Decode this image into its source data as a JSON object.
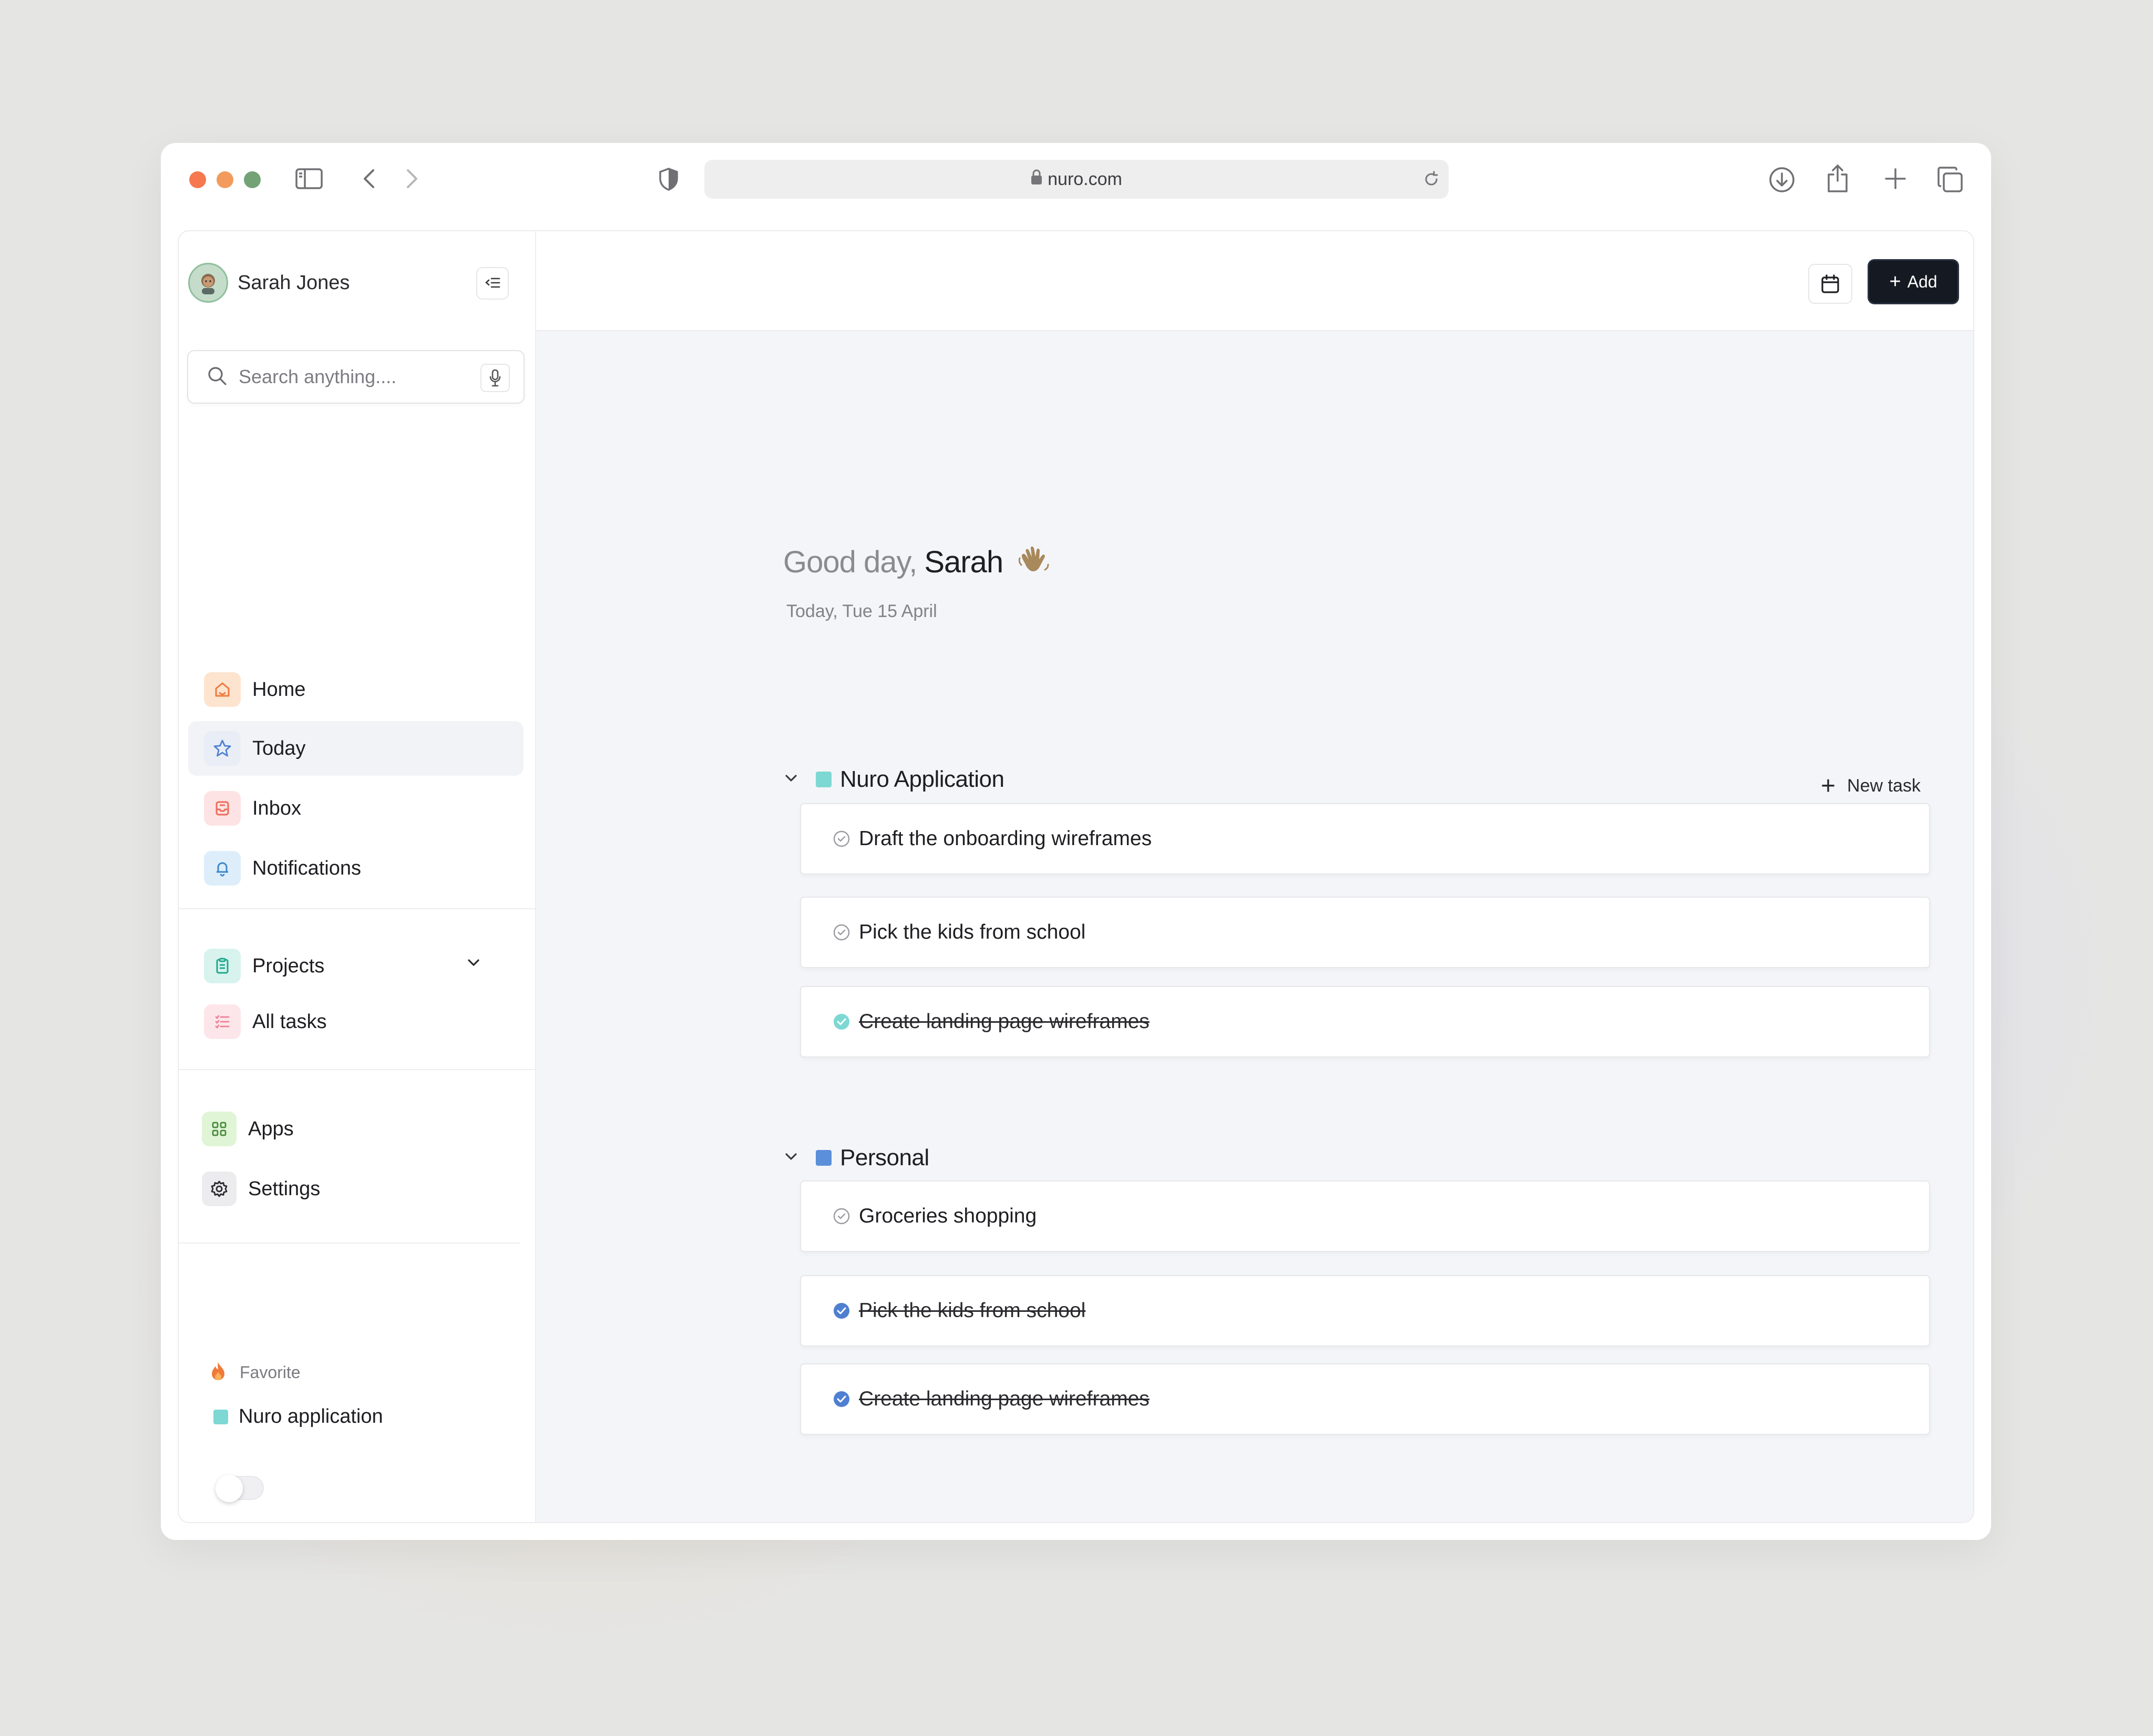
{
  "browser": {
    "url": "nuro.com"
  },
  "user": {
    "name": "Sarah Jones"
  },
  "search": {
    "placeholder": "Search anything...."
  },
  "nav": {
    "home": "Home",
    "today": "Today",
    "inbox": "Inbox",
    "notifications": "Notifications",
    "projects": "Projects",
    "all_tasks": "All tasks",
    "apps": "Apps",
    "settings": "Settings"
  },
  "favorite": {
    "title": "Favorite",
    "item": "Nuro application"
  },
  "toolbar": {
    "add_label": "Add"
  },
  "greeting": {
    "prefix": "Good day,",
    "name": "Sarah",
    "date": "Today, Tue 15 April"
  },
  "groups": [
    {
      "title": "Nuro Application",
      "color": "#7dd8d3",
      "new_task_label": "New task",
      "tasks": [
        {
          "label": "Draft the onboarding wireframes",
          "done": false
        },
        {
          "label": "Pick the kids from school",
          "done": false
        },
        {
          "label": "Create landing page wireframes",
          "done": true
        }
      ]
    },
    {
      "title": "Personal",
      "color": "#5b8fd9",
      "tasks": [
        {
          "label": "Groceries shopping",
          "done": false
        },
        {
          "label": "Pick the kids from school",
          "done": true
        },
        {
          "label": "Create landing page wireframes",
          "done": true
        }
      ]
    }
  ],
  "colors": {
    "accent_dark": "#151a22",
    "teal": "#7dd8d3",
    "blue": "#5b8fd9"
  }
}
